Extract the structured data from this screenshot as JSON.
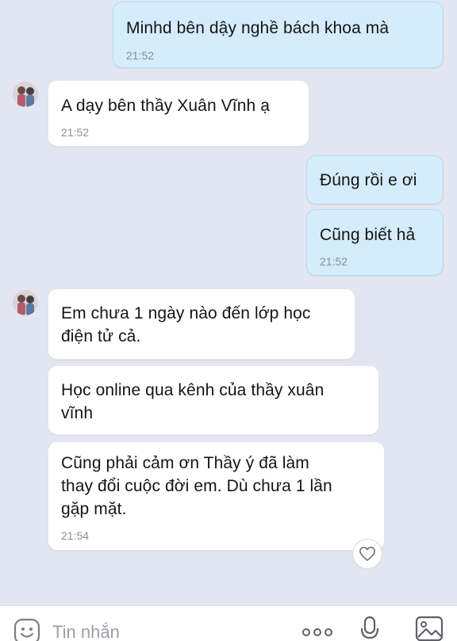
{
  "messages": [
    {
      "side": "out",
      "text": "Minhd bên dậy nghề bách khoa mà",
      "time": "21:52"
    },
    {
      "side": "in",
      "text": "A dạy bên thầy Xuân Vĩnh ạ",
      "time": "21:52"
    },
    {
      "side": "out",
      "text": "Đúng rồi e ơi",
      "time": ""
    },
    {
      "side": "out",
      "text": "Cũng biết hả",
      "time": "21:52"
    },
    {
      "side": "in",
      "text": "Em chưa 1 ngày nào đến lớp học\nđiện tử cả.",
      "time": ""
    },
    {
      "side": "in",
      "text": "Học online qua kênh của thầy xuân\nvĩnh",
      "time": ""
    },
    {
      "side": "in",
      "text": "Cũng phải cảm ơn Thầy ý đã làm\nthay đổi cuộc đời em. Dù chưa 1 lần\ngặp mặt.",
      "time": "21:54"
    }
  ],
  "composer": {
    "placeholder": "Tin nhắn",
    "emoji_icon": "emoji-icon",
    "more_icon": "more-dots-icon",
    "mic_icon": "microphone-icon",
    "image_icon": "image-icon"
  },
  "reaction_icon": "heart-icon",
  "colors": {
    "background": "#e2e6f0",
    "outgoing_bubble": "#d4ecfb",
    "incoming_bubble": "#ffffff",
    "timestamp": "#8b8e94"
  }
}
